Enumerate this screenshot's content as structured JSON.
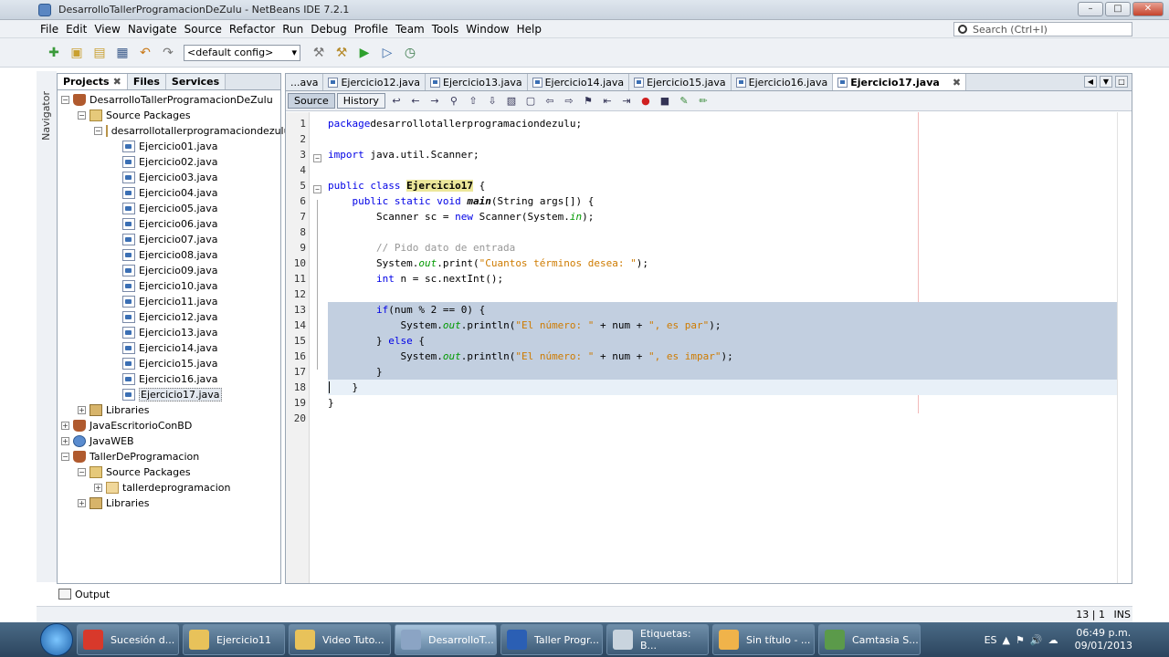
{
  "window": {
    "title": "DesarrolloTallerProgramacionDeZulu - NetBeans IDE 7.2.1"
  },
  "menu": [
    "File",
    "Edit",
    "View",
    "Navigate",
    "Source",
    "Refactor",
    "Run",
    "Debug",
    "Profile",
    "Team",
    "Tools",
    "Window",
    "Help"
  ],
  "search": {
    "placeholder": "Search (Ctrl+I)"
  },
  "toolbar": {
    "config": "<default config>"
  },
  "navigator_label": "Navigator",
  "project_tabs": [
    {
      "label": "Projects",
      "active": true
    },
    {
      "label": "Files"
    },
    {
      "label": "Services"
    }
  ],
  "tree": [
    {
      "label": "DesarrolloTallerProgramacionDeZulu",
      "indent": 0,
      "icon": "coffee",
      "toggle": "-"
    },
    {
      "label": "Source Packages",
      "indent": 1,
      "icon": "pkgs",
      "toggle": "-"
    },
    {
      "label": "desarrollotallerprogramaciondezulu",
      "indent": 2,
      "icon": "pkg",
      "toggle": "-"
    },
    {
      "label": "Ejercicio01.java",
      "indent": 3,
      "icon": "java"
    },
    {
      "label": "Ejercicio02.java",
      "indent": 3,
      "icon": "java"
    },
    {
      "label": "Ejercicio03.java",
      "indent": 3,
      "icon": "java"
    },
    {
      "label": "Ejercicio04.java",
      "indent": 3,
      "icon": "java"
    },
    {
      "label": "Ejercicio05.java",
      "indent": 3,
      "icon": "java"
    },
    {
      "label": "Ejercicio06.java",
      "indent": 3,
      "icon": "java"
    },
    {
      "label": "Ejercicio07.java",
      "indent": 3,
      "icon": "java"
    },
    {
      "label": "Ejercicio08.java",
      "indent": 3,
      "icon": "java"
    },
    {
      "label": "Ejercicio09.java",
      "indent": 3,
      "icon": "java"
    },
    {
      "label": "Ejercicio10.java",
      "indent": 3,
      "icon": "java"
    },
    {
      "label": "Ejercicio11.java",
      "indent": 3,
      "icon": "java"
    },
    {
      "label": "Ejercicio12.java",
      "indent": 3,
      "icon": "java"
    },
    {
      "label": "Ejercicio13.java",
      "indent": 3,
      "icon": "java"
    },
    {
      "label": "Ejercicio14.java",
      "indent": 3,
      "icon": "java"
    },
    {
      "label": "Ejercicio15.java",
      "indent": 3,
      "icon": "java"
    },
    {
      "label": "Ejercicio16.java",
      "indent": 3,
      "icon": "java"
    },
    {
      "label": "Ejercicio17.java",
      "indent": 3,
      "icon": "java",
      "selected": true
    },
    {
      "label": "Libraries",
      "indent": 1,
      "icon": "lib",
      "toggle": "+"
    },
    {
      "label": "JavaEscritorioConBD",
      "indent": 0,
      "icon": "coffee",
      "toggle": "+"
    },
    {
      "label": "JavaWEB",
      "indent": 0,
      "icon": "globe",
      "toggle": "+"
    },
    {
      "label": "TallerDeProgramacion",
      "indent": 0,
      "icon": "coffee",
      "toggle": "-"
    },
    {
      "label": "Source Packages",
      "indent": 1,
      "icon": "pkgs",
      "toggle": "-"
    },
    {
      "label": "tallerdeprogramacion",
      "indent": 2,
      "icon": "pkg",
      "toggle": "+"
    },
    {
      "label": "Libraries",
      "indent": 1,
      "icon": "lib",
      "toggle": "+"
    }
  ],
  "editor_tabs": [
    {
      "label": "...ava"
    },
    {
      "label": "Ejercicio12.java"
    },
    {
      "label": "Ejercicio13.java"
    },
    {
      "label": "Ejercicio14.java"
    },
    {
      "label": "Ejercicio15.java"
    },
    {
      "label": "Ejercicio16.java"
    },
    {
      "label": "Ejercicio17.java",
      "active": true
    }
  ],
  "editor_modes": {
    "source": "Source",
    "history": "History"
  },
  "code_lines": [
    [
      [
        "kw",
        "package"
      ],
      [
        "",
        "desarrollotallerprogramaciondezulu;"
      ]
    ],
    [],
    [
      [
        "kw",
        "import"
      ],
      [
        "",
        " java.util.Scanner;"
      ]
    ],
    [],
    [
      [
        "kw",
        "public class "
      ],
      [
        "cls",
        "Ejercicio17"
      ],
      [
        "",
        " {"
      ]
    ],
    [
      [
        "",
        "    "
      ],
      [
        "kw",
        "public static void "
      ],
      [
        "it b",
        "main"
      ],
      [
        "",
        "(String args[]) {"
      ]
    ],
    [
      [
        "",
        "        Scanner sc = "
      ],
      [
        "kw",
        "new"
      ],
      [
        "",
        " Scanner(System."
      ],
      [
        "it kwi",
        "in"
      ],
      [
        "",
        ");"
      ]
    ],
    [],
    [
      [
        "cm",
        "        // Pido dato de entrada"
      ]
    ],
    [
      [
        "",
        "        System."
      ],
      [
        "it kwi",
        "out"
      ],
      [
        "",
        ".print("
      ],
      [
        "str",
        "\"Cuantos términos desea: \""
      ],
      [
        "",
        ");"
      ]
    ],
    [
      [
        "",
        "        "
      ],
      [
        "kw",
        "int"
      ],
      [
        "",
        " n = sc.nextInt();"
      ]
    ],
    [],
    [
      [
        "",
        "        "
      ],
      [
        "kw",
        "if"
      ],
      [
        "",
        "(num % 2 == 0) {"
      ]
    ],
    [
      [
        "",
        "            System."
      ],
      [
        "it kwi",
        "out"
      ],
      [
        "",
        ".println("
      ],
      [
        "str",
        "\"El número: \""
      ],
      [
        "",
        " + num + "
      ],
      [
        "str",
        "\", es par\""
      ],
      [
        "",
        ");"
      ]
    ],
    [
      [
        "",
        "        } "
      ],
      [
        "kw",
        "else"
      ],
      [
        "",
        " {"
      ]
    ],
    [
      [
        "",
        "            System."
      ],
      [
        "it kwi",
        "out"
      ],
      [
        "",
        ".println("
      ],
      [
        "str",
        "\"El número: \""
      ],
      [
        "",
        " + num + "
      ],
      [
        "str",
        "\", es impar\""
      ],
      [
        "",
        ");"
      ]
    ],
    [
      [
        "",
        "        }"
      ]
    ],
    [
      [
        "",
        "    }"
      ]
    ],
    [
      [
        "",
        "}"
      ]
    ],
    []
  ],
  "output": {
    "label": "Output"
  },
  "status": {
    "position": "13 | 1",
    "mode": "INS"
  },
  "taskbar": [
    {
      "label": "Sucesión d...",
      "color": "#d8392b"
    },
    {
      "label": "Ejercicio11",
      "color": "#e8c25a"
    },
    {
      "label": "Video Tuto...",
      "color": "#e8c25a"
    },
    {
      "label": "DesarrolloT...",
      "color": "#8ba4c4",
      "active": true
    },
    {
      "label": "Taller Progr...",
      "color": "#2b5fb4"
    },
    {
      "label": "Etiquetas: B...",
      "color": "#c9d4de"
    },
    {
      "label": "Sin título - ...",
      "color": "#f0b34a"
    },
    {
      "label": "Camtasia S...",
      "color": "#5b9a4a"
    }
  ],
  "tray": {
    "lang": "ES",
    "time": "06:49 p.m.",
    "date": "09/01/2013"
  }
}
